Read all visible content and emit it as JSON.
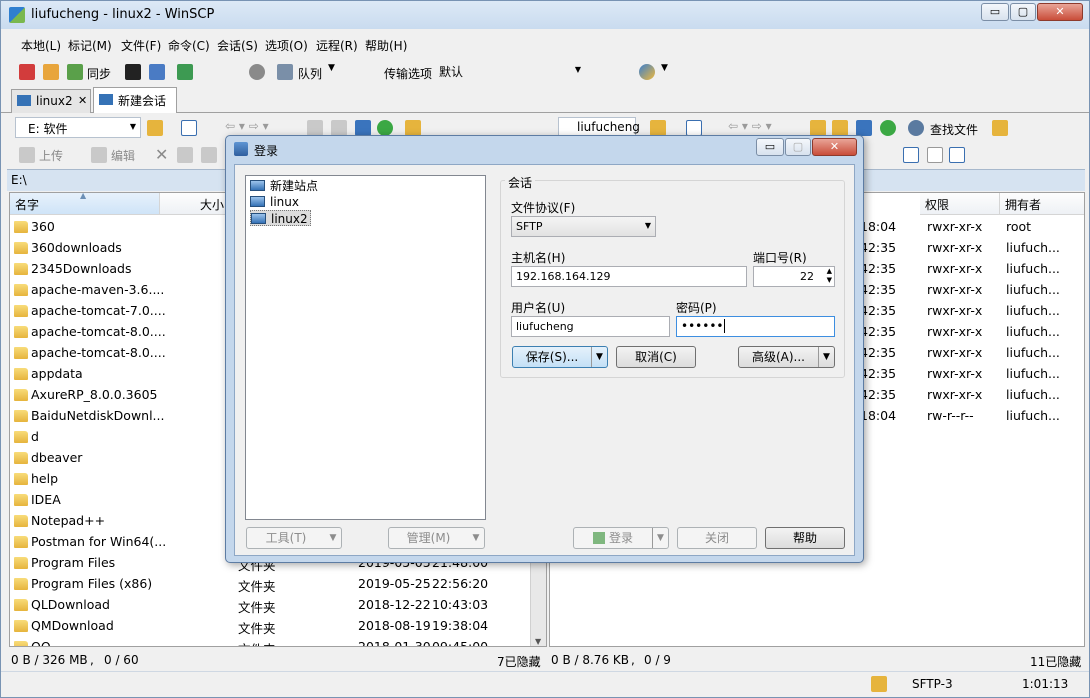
{
  "window": {
    "title": "liufucheng - linux2 - WinSCP",
    "btn_min": "▭",
    "btn_max": "▢",
    "btn_close": "✕"
  },
  "menu": [
    "本地(L)",
    "标记(M)",
    "文件(F)",
    "命令(C)",
    "会话(S)",
    "选项(O)",
    "远程(R)",
    "帮助(H)"
  ],
  "toolbar": {
    "sync": "同步",
    "queue": "队列",
    "transfer_label": "传输选项",
    "transfer_value": "默认"
  },
  "tabs": [
    {
      "label": "linux2",
      "close": "✕"
    },
    {
      "label": "新建会话"
    }
  ],
  "left_panel": {
    "drive": "E: 软件",
    "upload": "上传",
    "edit": "编辑",
    "path": "E:\\",
    "columns": {
      "name": "名字",
      "size": "大小"
    },
    "rows": [
      {
        "name": "360"
      },
      {
        "name": "360downloads"
      },
      {
        "name": "2345Downloads"
      },
      {
        "name": "apache-maven-3.6...."
      },
      {
        "name": "apache-tomcat-7.0...."
      },
      {
        "name": "apache-tomcat-8.0...."
      },
      {
        "name": "apache-tomcat-8.0...."
      },
      {
        "name": "appdata"
      },
      {
        "name": "AxureRP_8.0.0.3605"
      },
      {
        "name": "BaiduNetdiskDownl..."
      },
      {
        "name": "d"
      },
      {
        "name": "dbeaver"
      },
      {
        "name": "help"
      },
      {
        "name": "IDEA"
      },
      {
        "name": "Notepad++"
      },
      {
        "name": "Postman for Win64(..."
      },
      {
        "name": "Program Files",
        "type": "文件夹",
        "date": "2019-05-05",
        "time": "21:48:00"
      },
      {
        "name": "Program Files (x86)",
        "type": "文件夹",
        "date": "2019-05-25",
        "time": "22:56:20"
      },
      {
        "name": "QLDownload",
        "type": "文件夹",
        "date": "2018-12-22",
        "time": "10:43:03"
      },
      {
        "name": "QMDownload",
        "type": "文件夹",
        "date": "2018-08-19",
        "time": "19:38:04"
      },
      {
        "name": "QQ",
        "type": "文件夹",
        "date": "2018-01-30",
        "time": "09:45:00"
      }
    ],
    "status_size": "0 B / 326 MB",
    "status_count": "0 / 60",
    "hidden": "7已隐藏"
  },
  "right_panel": {
    "dir": "liufucheng",
    "find": "查找文件",
    "columns": {
      "perm": "权限",
      "owner": "拥有者"
    },
    "rows": [
      {
        "time": "18:04",
        "perm": "rwxr-xr-x",
        "owner": "root"
      },
      {
        "time": "42:35",
        "perm": "rwxr-xr-x",
        "owner": "liufuch..."
      },
      {
        "time": "42:35",
        "perm": "rwxr-xr-x",
        "owner": "liufuch..."
      },
      {
        "time": "42:35",
        "perm": "rwxr-xr-x",
        "owner": "liufuch..."
      },
      {
        "time": "42:35",
        "perm": "rwxr-xr-x",
        "owner": "liufuch..."
      },
      {
        "time": "42:35",
        "perm": "rwxr-xr-x",
        "owner": "liufuch..."
      },
      {
        "time": "42:35",
        "perm": "rwxr-xr-x",
        "owner": "liufuch..."
      },
      {
        "time": "42:35",
        "perm": "rwxr-xr-x",
        "owner": "liufuch..."
      },
      {
        "time": "42:35",
        "perm": "rwxr-xr-x",
        "owner": "liufuch..."
      },
      {
        "time": "18:04",
        "perm": "rw-r--r--",
        "owner": "liufuch..."
      }
    ],
    "status_size": "0 B / 8.76 KB",
    "status_count": "0 / 9",
    "hidden": "11已隐藏"
  },
  "statusbar": {
    "protocol": "SFTP-3",
    "elapsed": "1:01:13"
  },
  "dialog": {
    "title": "登录",
    "sites": [
      "新建站点",
      "linux",
      "linux2"
    ],
    "session_group": "会话",
    "protocol_label": "文件协议(F)",
    "protocol_value": "SFTP",
    "host_label": "主机名(H)",
    "host_value": "192.168.164.129",
    "port_label": "端口号(R)",
    "port_value": "22",
    "user_label": "用户名(U)",
    "user_value": "liufucheng",
    "pass_label": "密码(P)",
    "pass_value": "••••••",
    "save": "保存(S)...",
    "cancel": "取消(C)",
    "advanced": "高级(A)...",
    "tools": "工具(T)",
    "manage": "管理(M)",
    "login": "登录",
    "close": "关闭",
    "help": "帮助"
  }
}
